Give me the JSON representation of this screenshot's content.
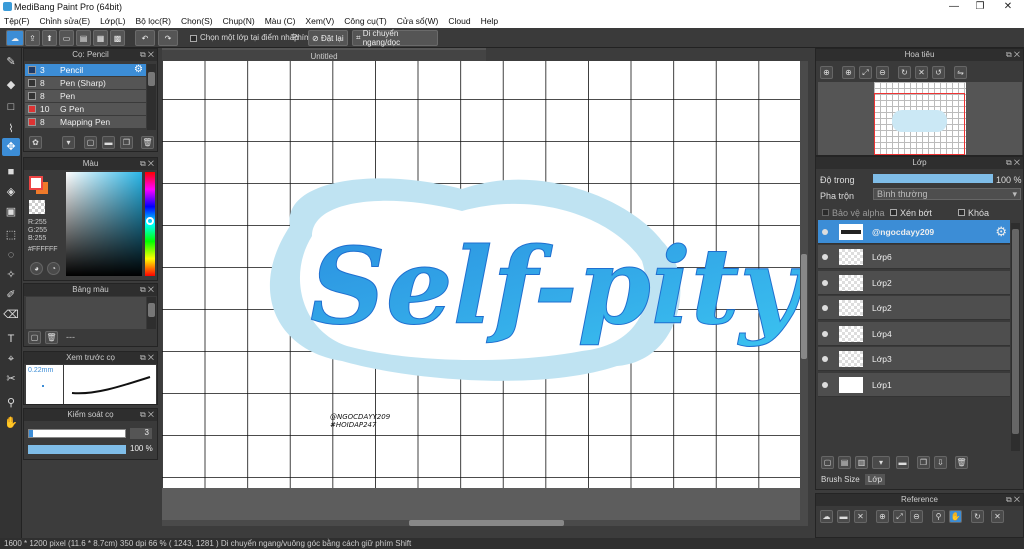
{
  "window": {
    "title": "MediBang Paint Pro (64bit)",
    "min": "—",
    "max": "❐",
    "close": "✕"
  },
  "menu": [
    "Tệp(F)",
    "Chỉnh sửa(E)",
    "Lớp(L)",
    "Bộ lọc(R)",
    "Chọn(S)",
    "Chụp(N)",
    "Màu (C)",
    "Xem(V)",
    "Công cụ(T)",
    "Cửa sổ(W)",
    "Cloud",
    "Help"
  ],
  "toolbar": {
    "select_one_layer": "Chọn một lớp tại điểm nhấp",
    "key": "Phím",
    "reset": "Đặt lại",
    "move_label": "Di chuyển ngang/dọc"
  },
  "brush_panel": {
    "title": "Cọ: Pencil",
    "items": [
      {
        "size": "3",
        "name": "Pencil",
        "color": "#1f3a66"
      },
      {
        "size": "8",
        "name": "Pen (Sharp)",
        "color": "#444"
      },
      {
        "size": "8",
        "name": "Pen",
        "color": "#444"
      },
      {
        "size": "10",
        "name": "G Pen",
        "color": "#d33"
      },
      {
        "size": "8",
        "name": "Mapping Pen",
        "color": "#d33"
      }
    ]
  },
  "color_panel": {
    "title": "Màu",
    "r": "R:255",
    "g": "G:255",
    "b": "B:255",
    "hex": "#FFFFFF"
  },
  "palette_panel": {
    "title": "Bảng màu",
    "dots": "---"
  },
  "brush_preview": {
    "title": "Xem trước cọ",
    "size": "0.22mm",
    "unit": "1 pixel"
  },
  "brush_control": {
    "title": "Kiểm soát cọ",
    "size": "3",
    "opacity": "100 %"
  },
  "canvas": {
    "tab": "Untitled",
    "lettering": "Self-pity",
    "watermark1": "@NGOCDAYY209",
    "watermark2": "#HOIDAP247"
  },
  "navigator": {
    "title": "Hoa tiêu"
  },
  "layer_panel": {
    "title": "Lớp",
    "opacity_label": "Độ trong",
    "opacity_value": "100 %",
    "opacity": 1.0,
    "blend_label": "Pha trộn",
    "blend_value": "Bình thường",
    "protect_alpha": "Bảo vệ alpha",
    "clipping": "Xén bớt",
    "lock": "Khóa",
    "layers": [
      {
        "name": "@ngocdayy209",
        "selected": true
      },
      {
        "name": "Lớp6",
        "selected": false
      },
      {
        "name": "Lớp2",
        "selected": false
      },
      {
        "name": "Lớp2",
        "selected": false
      },
      {
        "name": "Lớp4",
        "selected": false
      },
      {
        "name": "Lớp3",
        "selected": false
      },
      {
        "name": "Lớp1",
        "selected": false
      }
    ],
    "tabs": [
      "Brush Size",
      "Lớp"
    ]
  },
  "reference": {
    "title": "Reference"
  },
  "status": "1600 * 1200 pixel   (11.6 * 8.7cm)   350 dpi   66 %   ( 1243, 1281 )   Di chuyển ngang/vuông góc bằng cách giữ phím Shift"
}
